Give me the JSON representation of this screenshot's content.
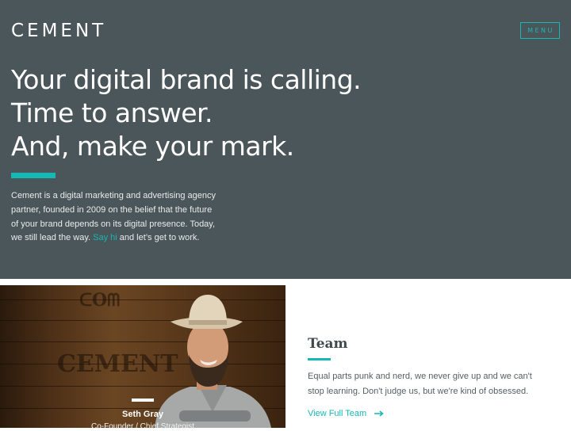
{
  "header": {
    "logo": "CEMENT",
    "menu_label": "MENU"
  },
  "hero": {
    "headline_lines": [
      "Your digital brand is calling.",
      "Time to answer.",
      "And, make your mark."
    ],
    "intro_before_link": "Cement is a digital marketing and advertising agency partner, founded in 2009 on the belief that the future of your brand depends on its digital presence. Today, we still lead the way. ",
    "intro_link": "Say hi",
    "intro_after_link": " and let’s get to work."
  },
  "team_photo": {
    "name": "Seth Gray",
    "role": "Co-Founder / Chief Strategist"
  },
  "team": {
    "title": "Team",
    "description": "Equal parts punk and nerd, we never give up and we can't stop learning. Don't judge us, but we're kind of obsessed.",
    "link_label": "View Full Team"
  },
  "colors": {
    "hero_bg": "#4b565a",
    "accent": "#16b8b5",
    "heading_dark": "#3f4a4e"
  },
  "icons": {
    "team_link": "arrow-right-icon"
  }
}
